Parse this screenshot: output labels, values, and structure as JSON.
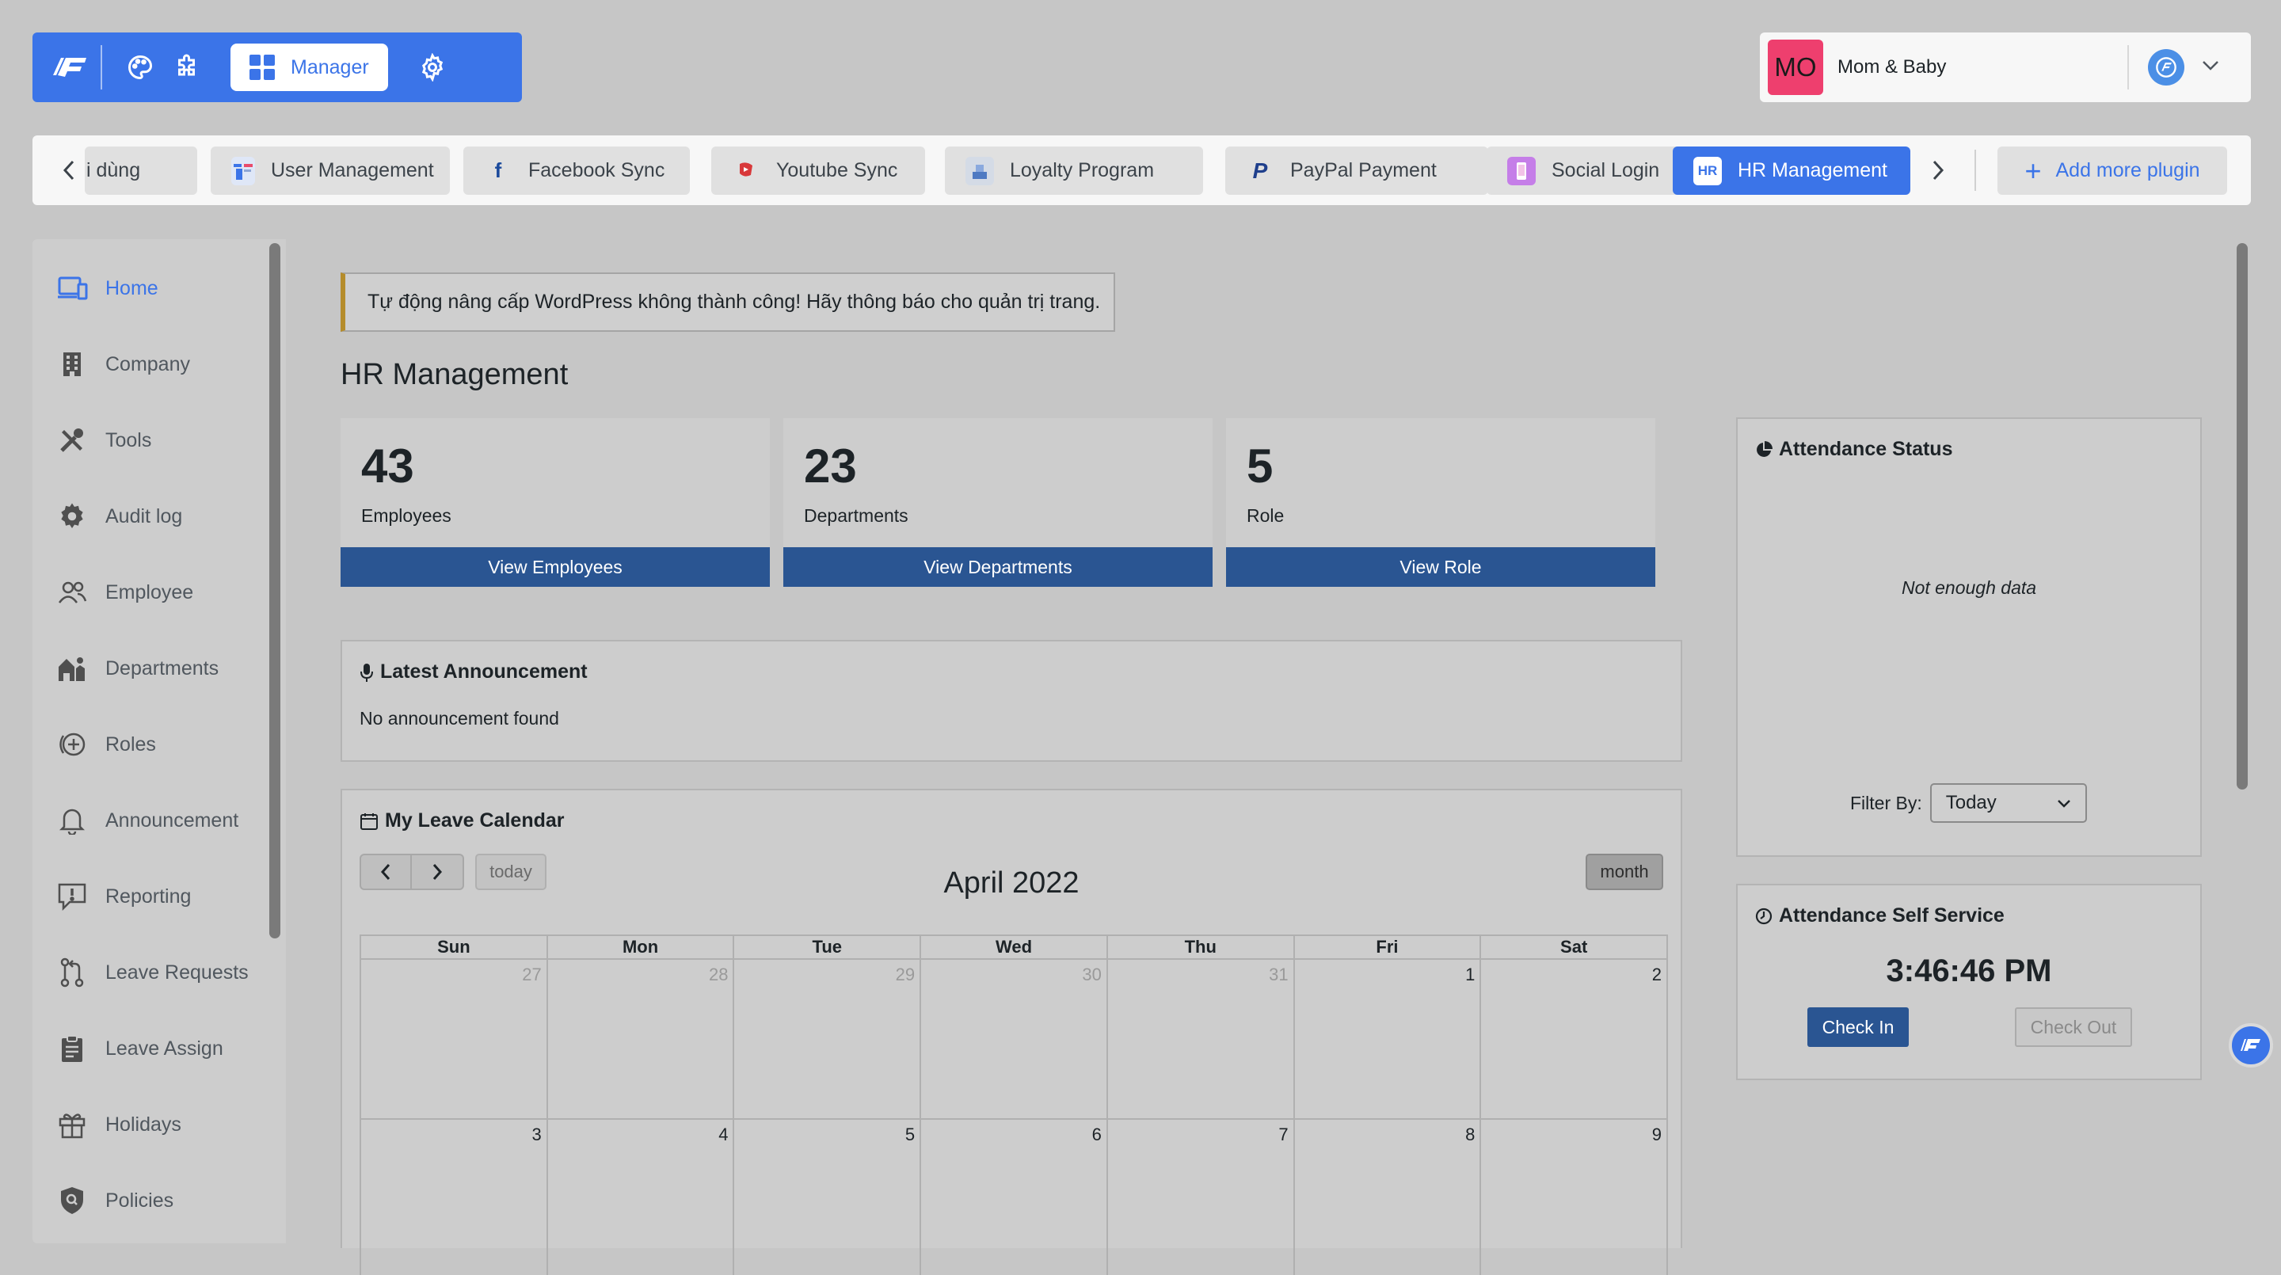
{
  "toolbar": {
    "manager_label": "Manager"
  },
  "site": {
    "avatar_initials": "MO",
    "name": "Mom & Baby"
  },
  "plugin_tabs": [
    {
      "label": "i dùng"
    },
    {
      "label": "User Management"
    },
    {
      "label": "Facebook Sync"
    },
    {
      "label": "Youtube Sync"
    },
    {
      "label": "Loyalty Program"
    },
    {
      "label": "PayPal Payment"
    },
    {
      "label": "Social Login"
    },
    {
      "label": "HR Management",
      "icon_text": "HR"
    }
  ],
  "add_plugin_label": "Add more plugin",
  "sidebar": {
    "items": [
      {
        "label": "Home",
        "icon": "monitor-icon"
      },
      {
        "label": "Company",
        "icon": "building-icon"
      },
      {
        "label": "Tools",
        "icon": "tools-icon"
      },
      {
        "label": "Audit log",
        "icon": "gear-icon"
      },
      {
        "label": "Employee",
        "icon": "users-icon"
      },
      {
        "label": "Departments",
        "icon": "departments-icon"
      },
      {
        "label": "Roles",
        "icon": "roles-icon"
      },
      {
        "label": "Announcement",
        "icon": "bell-icon"
      },
      {
        "label": "Reporting",
        "icon": "report-icon"
      },
      {
        "label": "Leave Requests",
        "icon": "pull-request-icon"
      },
      {
        "label": "Leave Assign",
        "icon": "clipboard-icon"
      },
      {
        "label": "Holidays",
        "icon": "gift-icon"
      },
      {
        "label": "Policies",
        "icon": "shield-icon"
      }
    ]
  },
  "notice": "Tự động nâng cấp WordPress không thành công! Hãy thông báo cho quản trị trang.",
  "page_title": "HR Management",
  "stats": [
    {
      "value": "43",
      "label": "Employees",
      "button": "View Employees"
    },
    {
      "value": "23",
      "label": "Departments",
      "button": "View Departments"
    },
    {
      "value": "5",
      "label": "Role",
      "button": "View Role"
    }
  ],
  "announcement": {
    "title": "Latest Announcement",
    "empty": "No announcement found"
  },
  "calendar": {
    "title": "My Leave Calendar",
    "today_label": "today",
    "month_label": "month",
    "heading": "April 2022",
    "weekdays": [
      "Sun",
      "Mon",
      "Tue",
      "Wed",
      "Thu",
      "Fri",
      "Sat"
    ],
    "rows": [
      [
        "27",
        "28",
        "29",
        "30",
        "31",
        "1",
        "2"
      ],
      [
        "3",
        "4",
        "5",
        "6",
        "7",
        "8",
        "9"
      ]
    ]
  },
  "attendance_status": {
    "title": "Attendance Status",
    "empty": "Not enough data",
    "filter_label": "Filter By:",
    "filter_value": "Today"
  },
  "self_service": {
    "title": "Attendance Self Service",
    "clock": "3:46:46 PM",
    "check_in": "Check In",
    "check_out": "Check Out"
  },
  "colors": {
    "accent": "#3b74e8",
    "button_dark": "#2a5592",
    "avatar_bg": "#ee3f6e",
    "notice_border": "#b58c2b"
  }
}
